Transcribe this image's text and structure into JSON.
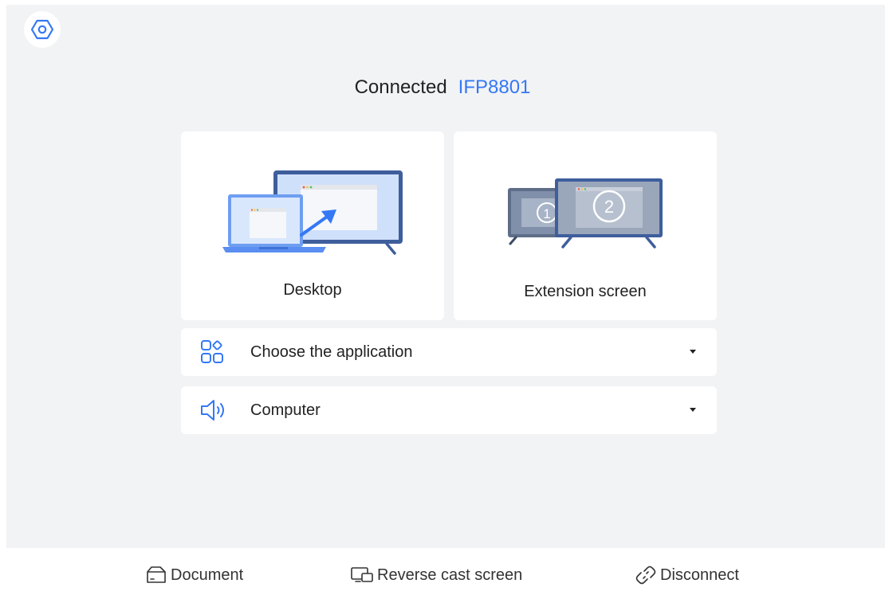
{
  "header": {
    "status_label": "Connected",
    "device_name": "IFP8801"
  },
  "icons": {
    "settings": "gear-icon",
    "apps": "apps-grid-icon",
    "audio": "speaker-icon",
    "document": "folder-icon",
    "reverse_cast": "reverse-cast-icon",
    "disconnect": "unlink-icon"
  },
  "modes": [
    {
      "label": "Desktop"
    },
    {
      "label": "Extension screen"
    }
  ],
  "extension_screens": [
    "1",
    "2"
  ],
  "selects": {
    "application": {
      "value": "Choose the application"
    },
    "audio_output": {
      "value": "Computer"
    }
  },
  "bottom_bar": {
    "document": "Document",
    "reverse_cast": "Reverse cast screen",
    "disconnect": "Disconnect"
  },
  "colors": {
    "accent": "#3478f6",
    "panel_background": "#f2f3f5",
    "card_background": "#ffffff",
    "text": "#222222"
  }
}
